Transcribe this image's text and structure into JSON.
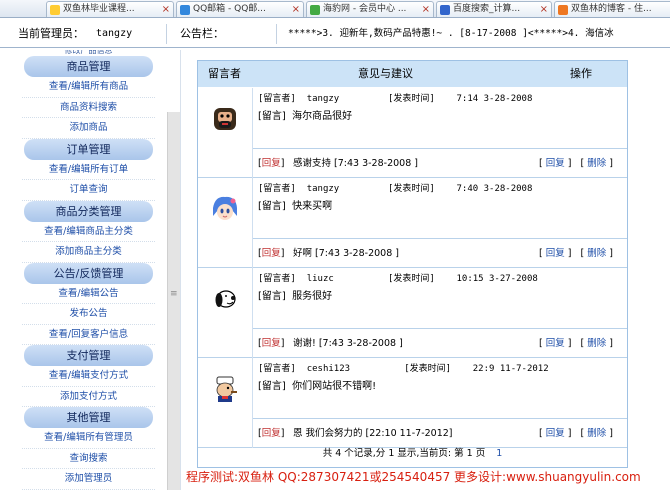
{
  "browser": {
    "tabs": [
      {
        "label": "双鱼林毕业课程...",
        "icon_color": "#ffcc33"
      },
      {
        "label": "QQ邮箱 - QQ邮...",
        "icon_color": "#3388dd"
      },
      {
        "label": "海豹网 - 会员中心 ...",
        "icon_color": "#44aa44"
      },
      {
        "label": "百度搜索_计算...",
        "icon_color": "#3366cc"
      },
      {
        "label": "双鱼林的博客 - 住...",
        "icon_color": "#ee7722"
      }
    ]
  },
  "topbar": {
    "admin_label": "当前管理员：",
    "admin_name": "tangzy",
    "bulletin_label": "公告栏：",
    "bulletin_text": "*****>3. 迎新年,数码产品特惠!~ . [8-17-2008 ]<*****>4. 海信冰"
  },
  "sidebar": {
    "stub": "修改产品信息",
    "sections": [
      {
        "title": "商品管理",
        "items": [
          "查看/编辑所有商品",
          "商品资料搜索",
          "添加商品"
        ]
      },
      {
        "title": "订单管理",
        "items": [
          "查看/编辑所有订单",
          "订单查询"
        ]
      },
      {
        "title": "商品分类管理",
        "items": [
          "查看/编辑商品主分类",
          "添加商品主分类"
        ]
      },
      {
        "title": "公告/反馈管理",
        "items": [
          "查看/编辑公告",
          "发布公告",
          "查看/回复客户信息"
        ]
      },
      {
        "title": "支付管理",
        "items": [
          "查看/编辑支付方式",
          "添加支付方式"
        ]
      },
      {
        "title": "其他管理",
        "items": [
          "查看/编辑所有管理员",
          "查询搜索",
          "添加管理员"
        ]
      }
    ]
  },
  "table": {
    "headers": [
      "留言者",
      "意见与建议",
      "操作"
    ],
    "messages": [
      {
        "avatar": "bearded-man-avatar",
        "author_label": "[留言者]",
        "author": "tangzy",
        "time_label": "[发表时间]",
        "time": "7:14 3-28-2008",
        "msg_label": "[留言]",
        "msg": "海尔商品很好",
        "reply_label": "回复",
        "reply": "感谢支持  [7:43 3-28-2008 ]",
        "op_reply": "回复",
        "op_delete": "删除"
      },
      {
        "avatar": "blue-hair-girl-avatar",
        "author_label": "[留言者]",
        "author": "tangzy",
        "time_label": "[发表时间]",
        "time": "7:40 3-28-2008",
        "msg_label": "[留言]",
        "msg": "快来买啊",
        "reply_label": "回复",
        "reply": "好啊  [7:43 3-28-2008 ]",
        "op_reply": "回复",
        "op_delete": "删除"
      },
      {
        "avatar": "snoopy-avatar",
        "author_label": "[留言者]",
        "author": "liuzc",
        "time_label": "[发表时间]",
        "time": "10:15 3-27-2008",
        "msg_label": "[留言]",
        "msg": "服务很好",
        "reply_label": "回复",
        "reply": "谢谢!  [7:43 3-28-2008 ]",
        "op_reply": "回复",
        "op_delete": "删除"
      },
      {
        "avatar": "popeye-avatar",
        "author_label": "[留言者]",
        "author": "ceshi123",
        "time_label": "[发表时间]",
        "time": "22:9 11-7-2012",
        "msg_label": "[留言]",
        "msg": "你们网站很不错啊!",
        "reply_label": "回复",
        "reply": "恩 我们会努力的  [22:10 11-7-2012]",
        "op_reply": "回复",
        "op_delete": "删除"
      }
    ],
    "footer": "共 4 个记录,分 1 显示,当前页: 第 1 页",
    "page_link": "1"
  },
  "watermark": "程序测试:双鱼林 QQ:287307421或254540457 更多设计:www.shuangyulin.com",
  "colors": {
    "accent": "#1f4fa8",
    "header_bg": "#cce3f7",
    "reply_red": "#c03030",
    "watermark_red": "#d82010"
  }
}
